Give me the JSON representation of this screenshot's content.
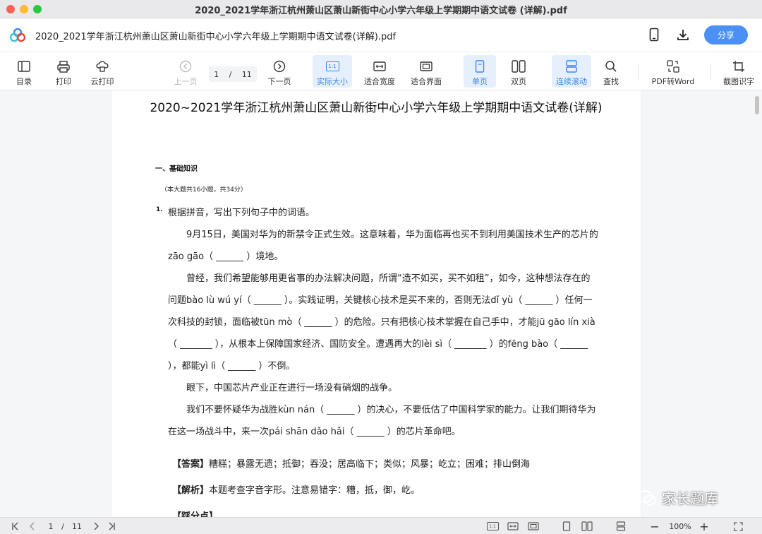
{
  "window": {
    "title": "2020_2021学年浙江杭州萧山区萧山新街中心小学六年级上学期期中语文试卷 (详解).pdf"
  },
  "header": {
    "file_name": "2020_2021学年浙江杭州萧山区萧山新街中心小学六年级上学期期中语文试卷(详解).pdf",
    "share_label": "分享"
  },
  "toolbar": {
    "toc": "目录",
    "print": "打印",
    "cloud_print": "云打印",
    "prev_page": "上一页",
    "current_page": "1",
    "separator": "/",
    "total_pages": "11",
    "next_page": "下一页",
    "actual_size": "实际大小",
    "fit_width": "适合宽度",
    "fit_page": "适合界面",
    "single_page": "单页",
    "double_page": "双页",
    "continuous": "连续滚动",
    "find": "查找",
    "pdf_to_word": "PDF转Word",
    "ocr": "截图识字",
    "actual_size_icon_text": "1:1"
  },
  "document": {
    "title": "2020~2021学年浙江杭州萧山区萧山新街中心小学六年级上学期期中语文试卷(详解)",
    "section_heading": "一、基础知识",
    "section_note": "（本大题共16小题，共34分）",
    "question_number": "1.",
    "instruction": "根据拼音，写出下列句子中的词语。",
    "paragraphs": [
      "9月15日，美国对华为的新禁令正式生效。这意味着，华为面临再也买不到利用美国技术生产的芯片的zāo gāo（ ______ ）境地。",
      "曾经，我们希望能够用更省事的办法解决问题，所谓“造不如买，买不如租”，如今，这种想法存在的问题bào lù wú yí（ ______ ）。实践证明，关键核心技术是买不来的，否则无法dǐ yù（ ______ ）任何一次科技的封锁，面临被tūn mò（ ______ ）的危险。只有把核心技术掌握在自己手中，才能jū gāo lín xià （ _______ ），从根本上保障国家经济、国防安全。遭遇再大的lèi sì（ _______ ）的fēng bào（ ______ ），都能yì lì（ ______ ）不倒。",
      "眼下，中国芯片产业正在进行一场没有硝烟的战争。",
      "我们不要怀疑华为战胜kùn nán（ ______ ）的决心，不要低估了中国科学家的能力。让我们期待华为在这一场战斗中，来一次pái shān dǎo hǎi（ ______ ）的芯片革命吧。"
    ],
    "answer_label": "【答案】",
    "answer_text": "糟糕；暴露无遗；抵御；吞没；居高临下；类似；风暴；屹立；困难；排山倒海",
    "analysis_label": "【解析】",
    "analysis_text": "本题考查字音字形。注意易错字：糟，抵，御，屹。",
    "scoring_label": "【踩分点】"
  },
  "statusbar": {
    "current_page": "1",
    "separator": "/",
    "total_pages": "11",
    "zoom": "100%",
    "actual_size_icon_text": "1:1"
  },
  "watermark": {
    "text": "家长题库"
  },
  "colors": {
    "accent": "#4a90f5",
    "active_bg": "#e6f0fd"
  }
}
